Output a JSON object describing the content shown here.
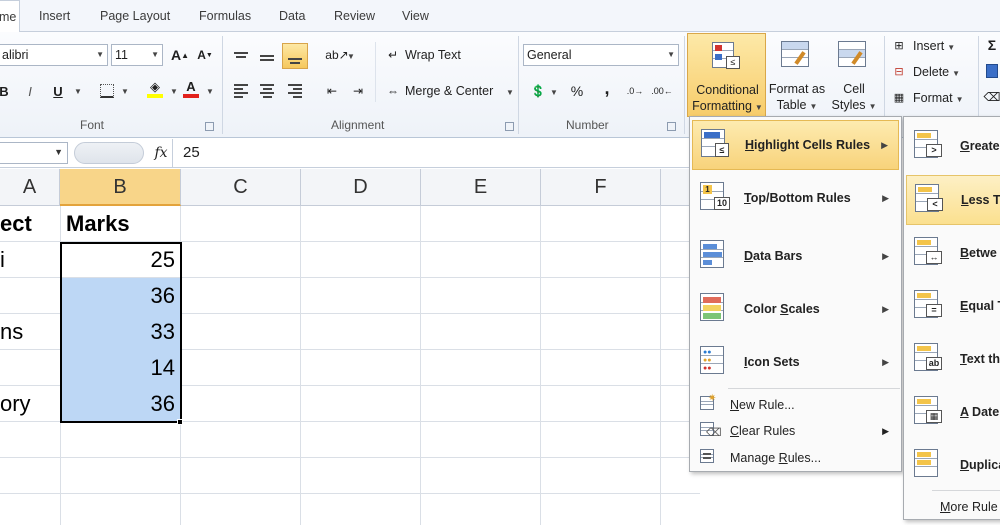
{
  "tabs": [
    {
      "label": "me",
      "active": true
    },
    {
      "label": "Insert"
    },
    {
      "label": "Page Layout"
    },
    {
      "label": "Formulas"
    },
    {
      "label": "Data"
    },
    {
      "label": "Review"
    },
    {
      "label": "View"
    }
  ],
  "ribbon": {
    "font_name": "alibri",
    "font_size": "11",
    "font_group": "Font",
    "alignment_group": "Alignment",
    "number_group": "Number",
    "wrap_text": "Wrap Text",
    "merge_center": "Merge & Center",
    "number_format": "General",
    "percent": "%",
    "comma": ",",
    "bold": "B",
    "underline": "U",
    "conditional_formatting": [
      "Conditional",
      "Formatting"
    ],
    "format_as_table": [
      "Format as",
      "Table"
    ],
    "cell_styles": [
      "Cell",
      "Styles"
    ],
    "insert": "Insert",
    "delete": "Delete",
    "format": "Format"
  },
  "formula_bar": {
    "fx": "fx",
    "value": "25"
  },
  "sheet": {
    "columns": [
      "A",
      "B",
      "C",
      "D",
      "E",
      "F"
    ],
    "selected_column": "B",
    "rows": [
      {
        "a": "ect",
        "b": "Marks",
        "header": true
      },
      {
        "a": "i",
        "b": "25"
      },
      {
        "a": "",
        "b": "36"
      },
      {
        "a": "ns",
        "b": "33"
      },
      {
        "a": "",
        "b": "14"
      },
      {
        "a": "ory",
        "b": "36"
      },
      {
        "a": "",
        "b": ""
      },
      {
        "a": "",
        "b": ""
      },
      {
        "a": "",
        "b": ""
      }
    ]
  },
  "cf_menu": {
    "items": [
      {
        "label": "Highlight Cells Rules",
        "key": "H",
        "rest": "ighlight Cells Rules",
        "icon": "highlight-cells-icon"
      },
      {
        "label": "Top/Bottom Rules",
        "key": "T",
        "rest": "op/Bottom Rules",
        "icon": "top-bottom-icon"
      },
      {
        "label": "Data Bars",
        "key": "D",
        "rest": "ata Bars",
        "icon": "data-bars-icon"
      },
      {
        "label": "Color Scales",
        "key": "S",
        "pre": "Color ",
        "rest": "cales",
        "icon": "color-scales-icon"
      },
      {
        "label": "Icon Sets",
        "key": "I",
        "rest": "con Sets",
        "icon": "icon-sets-icon"
      }
    ],
    "small_items": [
      {
        "key": "N",
        "rest": "ew Rule...",
        "icon": "new-rule-icon"
      },
      {
        "key": "C",
        "rest": "lear Rules",
        "icon": "clear-rules-icon"
      },
      {
        "pre": "Manage ",
        "key": "R",
        "rest": "ules...",
        "icon": "manage-rules-icon"
      }
    ]
  },
  "submenu": {
    "items": [
      {
        "key": "G",
        "rest": "reater",
        "icon": "greater-than-icon"
      },
      {
        "key": "L",
        "rest": "ess Th",
        "icon": "less-than-icon"
      },
      {
        "key": "B",
        "rest": "etwe",
        "icon": "between-icon"
      },
      {
        "key": "E",
        "rest": "qual T",
        "icon": "equal-to-icon"
      },
      {
        "key": "T",
        "rest": "ext th",
        "icon": "text-contains-icon"
      },
      {
        "key": "A",
        "rest": " Date",
        "icon": "date-occurring-icon"
      },
      {
        "key": "D",
        "rest": "uplica",
        "icon": "duplicate-values-icon"
      }
    ],
    "more": {
      "key": "M",
      "rest": "ore Rule"
    }
  },
  "colors": {
    "accent_hover": "#f8d37b",
    "selection": "#bdd7f5",
    "font_color": "#e2211c",
    "highlight": "#ffff00"
  }
}
